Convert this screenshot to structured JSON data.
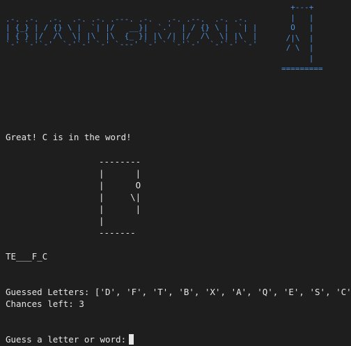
{
  "banner": {
    "art": ".-. .-.  .-.  .-. .-. .---. .-.   .-. .--.  .-. .-.\n| {_} | / {} \\ |  `| |/   __}|  `.'  | / {} \\ |  `| |\n| { } |/  /\\  \\| |\\  |\\  {_ }| |\\ /| |/  /\\  \\| |\\  |\n`-' `-'`-'  `-'`-' `-' `---' `-' ` `-'`-'  `-'`-' `-'",
    "gallows_art": "  +---+\n  |   |\n  O   |\n /|\\  |\n / \\  |\n      |\n=========",
    "color": "#4a8fdc"
  },
  "message": "Great! C is in the word!",
  "hangman_art": "--------\n|      |\n|      O\n|     \\|\n|      |\n|\n-------",
  "word_progress": "TE___F_C",
  "guessed_line": "Guessed Letters: ['D', 'F', 'T', 'B', 'X', 'A', 'Q', 'E', 'S', 'C']",
  "chances_line": "Chances left: 3",
  "prompt_text": "Guess a letter or word:",
  "colors": {
    "background": "#1e1e1e",
    "text": "#e6e6e6"
  }
}
